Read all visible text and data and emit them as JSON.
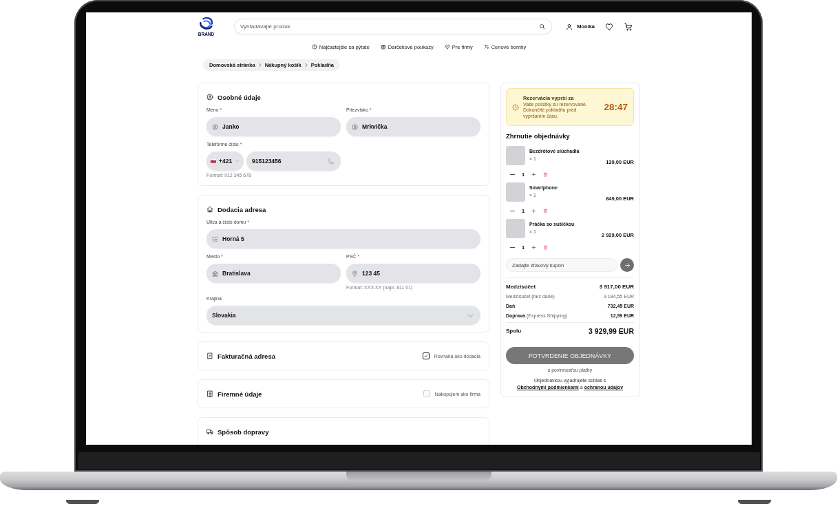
{
  "header": {
    "logo_text": "BRAND",
    "search": {
      "placeholder": "Vyhľadávajte produk"
    },
    "account": {
      "name": "Monika"
    }
  },
  "nav_links": [
    {
      "kind": "faq",
      "label": "Najčastejšie sa pýtate"
    },
    {
      "kind": "gifts",
      "label": "Darčekové poukazy"
    },
    {
      "kind": "business",
      "label": "Pre firmy"
    },
    {
      "kind": "deals",
      "label": "Cenové bomby"
    }
  ],
  "breadcrumb": [
    {
      "label": "Domovská stránka"
    },
    {
      "label": "Nákupný košík"
    },
    {
      "label": "Pokladňa"
    }
  ],
  "sections": [
    {
      "kind": "personal",
      "title": "Osobné údaje",
      "fields": [
        {
          "kind": "first_name",
          "label": "Meno",
          "required_mark": "*",
          "value": "Janko"
        },
        {
          "kind": "last_name",
          "label": "Priezvisko",
          "required_mark": "*",
          "value": "Mrkvička"
        },
        {
          "kind": "phone",
          "label": "Telefónne číslo",
          "required_mark": "*",
          "country_code": "+421",
          "value": "915123456",
          "hint": "Formát: 912 345 678"
        }
      ]
    },
    {
      "kind": "delivery",
      "title": "Dodacia adresa",
      "fields": [
        {
          "kind": "street",
          "label": "Ulica a číslo domu",
          "required_mark": "*",
          "value": "Horná 5"
        },
        {
          "kind": "city",
          "label": "Mesto",
          "required_mark": "*",
          "value": "Bratislava"
        },
        {
          "kind": "postal_code",
          "label": "PSČ",
          "required_mark": "*",
          "value": "123 45",
          "hint": "Formát: XXX XX (napr. 811 01)"
        },
        {
          "kind": "country",
          "label": "Krajina",
          "value": "Slovakia"
        }
      ]
    },
    {
      "kind": "billing",
      "title": "Fakturačná adresa",
      "option": {
        "label": "Rovnaká ako dodacia",
        "checked": true
      }
    },
    {
      "kind": "company",
      "title": "Firemné údaje",
      "option": {
        "label": "Nakupujem ako firma",
        "checked": false
      }
    },
    {
      "kind": "shipping",
      "title": "Spôsob dopravy"
    }
  ],
  "order_summary": {
    "reservation": {
      "title": "Rezervácia vyprší za",
      "message": "Vaše položky sú rezervované. Dokončite pokladňu pred vypršaním času.",
      "countdown": "28:47"
    },
    "title": "Zhrnutie objednávky",
    "items": [
      {
        "name": "Bezdrôtové slúchadlá",
        "quantity_label": "× 1",
        "price": "139,00 EUR",
        "quantity": "1"
      },
      {
        "name": "Smartphone",
        "quantity_label": "× 1",
        "price": "849,00 EUR",
        "quantity": "1"
      },
      {
        "name": "Práčka so sušičkou",
        "quantity_label": "× 1",
        "price": "2 929,00 EUR",
        "quantity": "1"
      }
    ],
    "coupon": {
      "placeholder": "Zadajte zľavový kupón"
    },
    "totals": [
      {
        "kind": "strong",
        "label": "Medzisúčet",
        "value": "3 917,00 EUR"
      },
      {
        "kind": "muted",
        "label": "Medzisúčet (bez dane)",
        "value": "3 184,55 EUR"
      },
      {
        "kind": "normal",
        "label": "Daň",
        "value": "732,45 EUR"
      },
      {
        "kind": "normal",
        "label": "Doprava",
        "note": "(Express Shipping)",
        "value": "12,99 EUR"
      }
    ],
    "total": {
      "label": "Spolu",
      "value": "3 929,99 EUR"
    },
    "confirm_button": "POTVRDENIE OBJEDNÁVKY",
    "payment_note": "s povinnosťou platby",
    "consent": [
      {
        "kind": "text",
        "text": "Objednávkou vyjadrujete súhlas s"
      },
      {
        "kind": "link",
        "text": "Obchodnými podmienkami"
      },
      {
        "kind": "text",
        "text": "a"
      },
      {
        "kind": "link",
        "text": "ochranou údajov"
      }
    ]
  }
}
